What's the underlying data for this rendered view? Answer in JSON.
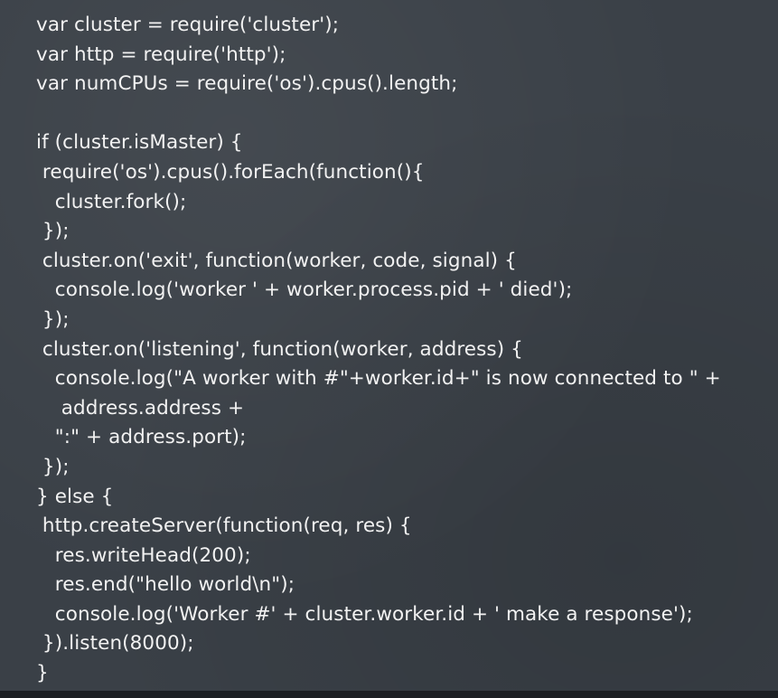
{
  "code": {
    "lines": [
      "var cluster = require('cluster');",
      "var http = require('http');",
      "var numCPUs = require('os').cpus().length;",
      "",
      "if (cluster.isMaster) {",
      " require('os').cpus().forEach(function(){",
      "   cluster.fork();",
      " });",
      " cluster.on('exit', function(worker, code, signal) {",
      "   console.log('worker ' + worker.process.pid + ' died');",
      " });",
      " cluster.on('listening', function(worker, address) {",
      "   console.log(\"A worker with #\"+worker.id+\" is now connected to \" +",
      "    address.address +",
      "   \":\" + address.port);",
      " });",
      "} else {",
      " http.createServer(function(req, res) {",
      "   res.writeHead(200);",
      "   res.end(\"hello world\\n\");",
      "   console.log('Worker #' + cluster.worker.id + ' make a response');",
      " }).listen(8000);",
      "}"
    ]
  },
  "colors": {
    "background": "#3a4047",
    "text": "#f2f2f2"
  }
}
